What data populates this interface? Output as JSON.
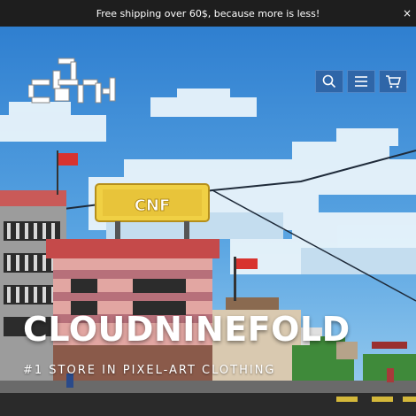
{
  "announcement": {
    "text": "Free shipping over 60$, because more is less!",
    "close_label": "×"
  },
  "header": {
    "logo_name": "cloudninefold-logo",
    "icons": [
      "search-icon",
      "menu-icon",
      "cart-icon"
    ]
  },
  "hero": {
    "title": "CLOUDNINEFOLD",
    "subtitle": "#1 STORE IN PIXEL-ART CLOTHING",
    "billboard_text": "CNF"
  },
  "colors": {
    "announcement_bg": "#1e1e1e",
    "sky": "#3f8fd8",
    "icon_bg": "#2f66a8",
    "billboard": "#f0d044"
  }
}
